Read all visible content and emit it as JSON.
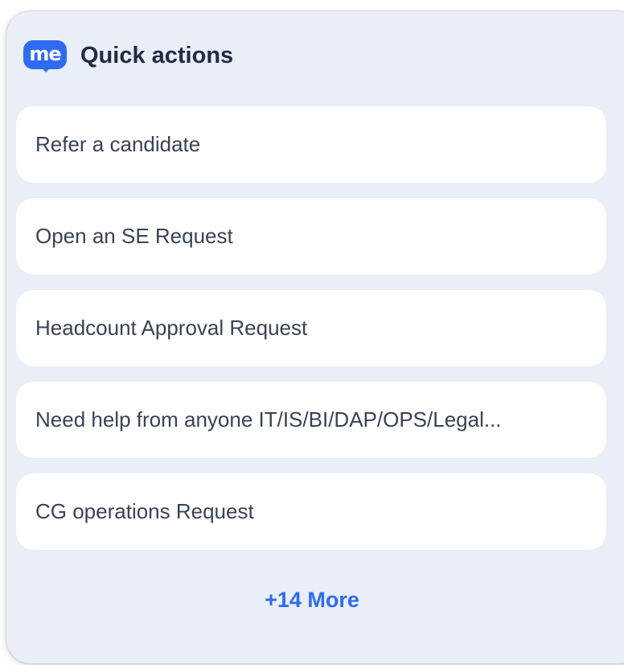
{
  "widget": {
    "logo_text": "me",
    "title": "Quick actions",
    "accent_color": "#2f6bf0",
    "background_color": "#e9eef7"
  },
  "actions": [
    {
      "label": "Refer a candidate"
    },
    {
      "label": "Open an SE Request"
    },
    {
      "label": "Headcount Approval Request"
    },
    {
      "label": "Need help from anyone IT/IS/BI/DAP/OPS/Legal..."
    },
    {
      "label": "CG operations Request"
    }
  ],
  "more_label": "+14 More"
}
